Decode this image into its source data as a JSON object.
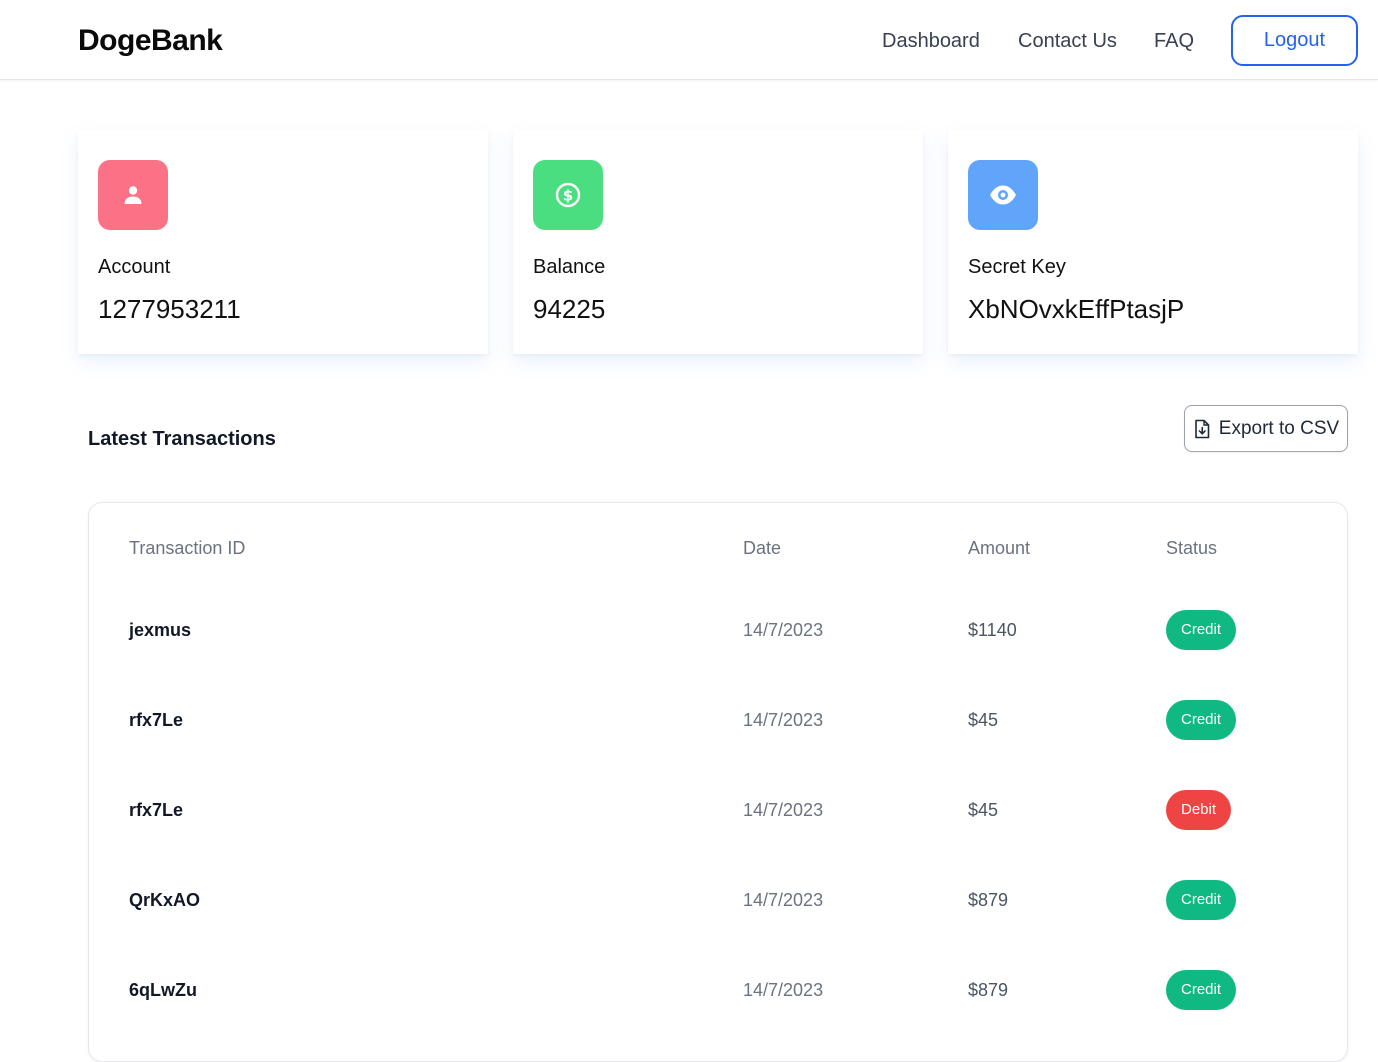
{
  "header": {
    "brand": "DogeBank",
    "nav": {
      "dashboard": "Dashboard",
      "contact": "Contact Us",
      "faq": "FAQ"
    },
    "logout_label": "Logout"
  },
  "cards": [
    {
      "label": "Account",
      "value": "1277953211",
      "icon": "user-icon",
      "color": "#fb7185"
    },
    {
      "label": "Balance",
      "value": "94225",
      "icon": "dollar-icon",
      "color": "#4ade80"
    },
    {
      "label": "Secret Key",
      "value": "XbNOvxkEffPtasjP",
      "icon": "eye-icon",
      "color": "#60a5fa"
    }
  ],
  "transactions": {
    "title": "Latest Transactions",
    "export_label": "Export to CSV",
    "columns": {
      "id": "Transaction ID",
      "date": "Date",
      "amount": "Amount",
      "status": "Status"
    },
    "rows": [
      {
        "id": "jexmus",
        "date": "14/7/2023",
        "amount": "$1140",
        "status": "Credit"
      },
      {
        "id": "rfx7Le",
        "date": "14/7/2023",
        "amount": "$45",
        "status": "Credit"
      },
      {
        "id": "rfx7Le",
        "date": "14/7/2023",
        "amount": "$45",
        "status": "Debit"
      },
      {
        "id": "QrKxAO",
        "date": "14/7/2023",
        "amount": "$879",
        "status": "Credit"
      },
      {
        "id": "6qLwZu",
        "date": "14/7/2023",
        "amount": "$879",
        "status": "Credit"
      }
    ]
  },
  "colors": {
    "accent": "#2563eb",
    "credit": "#10b981",
    "debit": "#ef4444"
  }
}
